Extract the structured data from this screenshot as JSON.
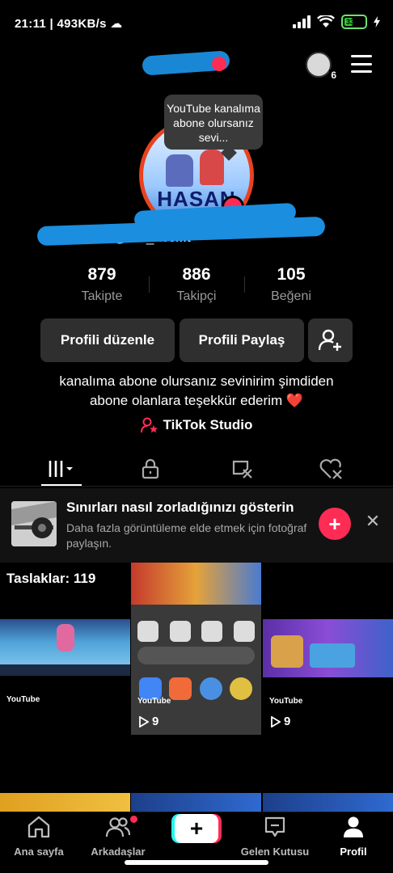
{
  "status_bar": {
    "time": "21:11",
    "network_speed": "493KB/s",
    "battery_level": "33",
    "battery_color": "#36c236"
  },
  "top_nav": {
    "friends_count": "6"
  },
  "avatar": {
    "title_text": "HASAN"
  },
  "tooltip": {
    "text": "YouTube kanalıma abone olursanız sevi..."
  },
  "profile": {
    "username": "fan_acc...t"
  },
  "stats": [
    {
      "value": "879",
      "label": "Takipte"
    },
    {
      "value": "886",
      "label": "Takipçi"
    },
    {
      "value": "105",
      "label": "Beğeni"
    }
  ],
  "buttons": {
    "edit_label": "Profili düzenle",
    "share_label": "Profili Paylaş"
  },
  "bio": {
    "line1": "kanalıma abone olursanız sevinirim şimdiden",
    "line2": "abone olanlara teşekkür ederim",
    "heart": "❤️"
  },
  "studio": {
    "label": "TikTok Studio"
  },
  "promo": {
    "title": "Sınırları nasıl zorladığınızı gösterin",
    "description": "Daha fazla görüntüleme elde etmek için fotoğraf paylaşın."
  },
  "grid": {
    "drafts_label": "Taslaklar: 119",
    "watermark": "YouTube",
    "items": [
      {
        "views": "9"
      },
      {
        "views": "9"
      }
    ]
  },
  "bottom_nav": {
    "items": [
      {
        "label": "Ana sayfa",
        "icon": "home-icon"
      },
      {
        "label": "Arkadaşlar",
        "icon": "friends-icon"
      },
      {
        "label": "+",
        "icon": "create-icon"
      },
      {
        "label": "Gelen Kutusu",
        "icon": "inbox-icon"
      },
      {
        "label": "Profil",
        "icon": "profile-icon"
      }
    ]
  },
  "colors": {
    "accent": "#fe2c55",
    "button_bg": "#2f2f2f",
    "scribble": "#1b8ee0"
  }
}
